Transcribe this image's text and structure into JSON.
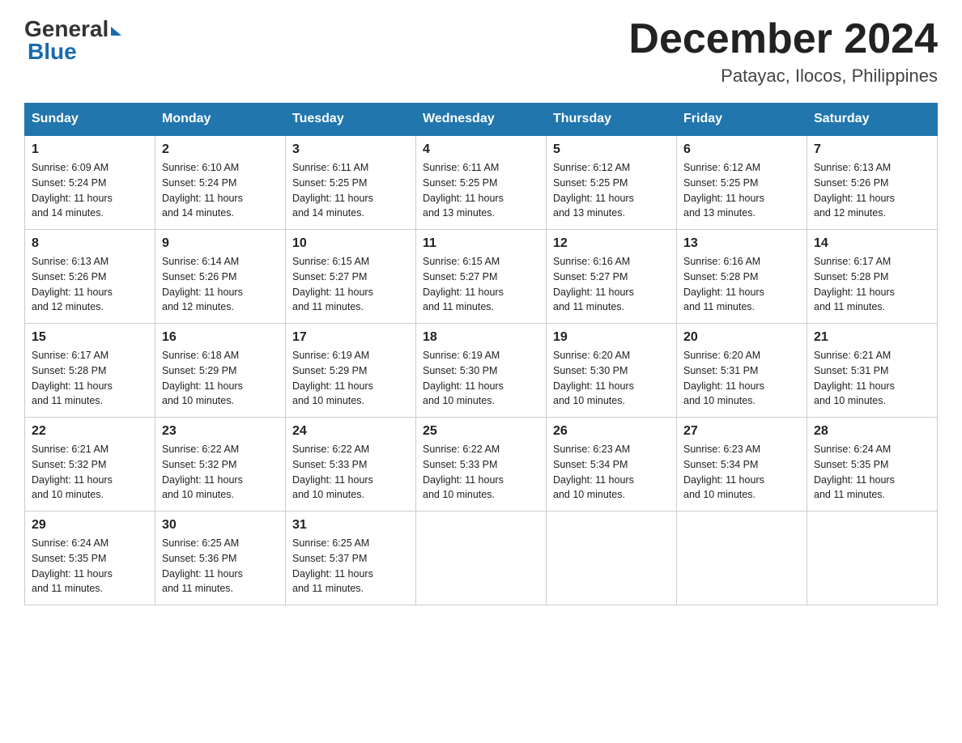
{
  "header": {
    "logo_general": "General",
    "logo_blue": "Blue",
    "month_title": "December 2024",
    "location": "Patayac, Ilocos, Philippines"
  },
  "days_of_week": [
    "Sunday",
    "Monday",
    "Tuesday",
    "Wednesday",
    "Thursday",
    "Friday",
    "Saturday"
  ],
  "weeks": [
    [
      {
        "day": "1",
        "sunrise": "6:09 AM",
        "sunset": "5:24 PM",
        "daylight": "11 hours and 14 minutes."
      },
      {
        "day": "2",
        "sunrise": "6:10 AM",
        "sunset": "5:24 PM",
        "daylight": "11 hours and 14 minutes."
      },
      {
        "day": "3",
        "sunrise": "6:11 AM",
        "sunset": "5:25 PM",
        "daylight": "11 hours and 14 minutes."
      },
      {
        "day": "4",
        "sunrise": "6:11 AM",
        "sunset": "5:25 PM",
        "daylight": "11 hours and 13 minutes."
      },
      {
        "day": "5",
        "sunrise": "6:12 AM",
        "sunset": "5:25 PM",
        "daylight": "11 hours and 13 minutes."
      },
      {
        "day": "6",
        "sunrise": "6:12 AM",
        "sunset": "5:25 PM",
        "daylight": "11 hours and 13 minutes."
      },
      {
        "day": "7",
        "sunrise": "6:13 AM",
        "sunset": "5:26 PM",
        "daylight": "11 hours and 12 minutes."
      }
    ],
    [
      {
        "day": "8",
        "sunrise": "6:13 AM",
        "sunset": "5:26 PM",
        "daylight": "11 hours and 12 minutes."
      },
      {
        "day": "9",
        "sunrise": "6:14 AM",
        "sunset": "5:26 PM",
        "daylight": "11 hours and 12 minutes."
      },
      {
        "day": "10",
        "sunrise": "6:15 AM",
        "sunset": "5:27 PM",
        "daylight": "11 hours and 11 minutes."
      },
      {
        "day": "11",
        "sunrise": "6:15 AM",
        "sunset": "5:27 PM",
        "daylight": "11 hours and 11 minutes."
      },
      {
        "day": "12",
        "sunrise": "6:16 AM",
        "sunset": "5:27 PM",
        "daylight": "11 hours and 11 minutes."
      },
      {
        "day": "13",
        "sunrise": "6:16 AM",
        "sunset": "5:28 PM",
        "daylight": "11 hours and 11 minutes."
      },
      {
        "day": "14",
        "sunrise": "6:17 AM",
        "sunset": "5:28 PM",
        "daylight": "11 hours and 11 minutes."
      }
    ],
    [
      {
        "day": "15",
        "sunrise": "6:17 AM",
        "sunset": "5:28 PM",
        "daylight": "11 hours and 11 minutes."
      },
      {
        "day": "16",
        "sunrise": "6:18 AM",
        "sunset": "5:29 PM",
        "daylight": "11 hours and 10 minutes."
      },
      {
        "day": "17",
        "sunrise": "6:19 AM",
        "sunset": "5:29 PM",
        "daylight": "11 hours and 10 minutes."
      },
      {
        "day": "18",
        "sunrise": "6:19 AM",
        "sunset": "5:30 PM",
        "daylight": "11 hours and 10 minutes."
      },
      {
        "day": "19",
        "sunrise": "6:20 AM",
        "sunset": "5:30 PM",
        "daylight": "11 hours and 10 minutes."
      },
      {
        "day": "20",
        "sunrise": "6:20 AM",
        "sunset": "5:31 PM",
        "daylight": "11 hours and 10 minutes."
      },
      {
        "day": "21",
        "sunrise": "6:21 AM",
        "sunset": "5:31 PM",
        "daylight": "11 hours and 10 minutes."
      }
    ],
    [
      {
        "day": "22",
        "sunrise": "6:21 AM",
        "sunset": "5:32 PM",
        "daylight": "11 hours and 10 minutes."
      },
      {
        "day": "23",
        "sunrise": "6:22 AM",
        "sunset": "5:32 PM",
        "daylight": "11 hours and 10 minutes."
      },
      {
        "day": "24",
        "sunrise": "6:22 AM",
        "sunset": "5:33 PM",
        "daylight": "11 hours and 10 minutes."
      },
      {
        "day": "25",
        "sunrise": "6:22 AM",
        "sunset": "5:33 PM",
        "daylight": "11 hours and 10 minutes."
      },
      {
        "day": "26",
        "sunrise": "6:23 AM",
        "sunset": "5:34 PM",
        "daylight": "11 hours and 10 minutes."
      },
      {
        "day": "27",
        "sunrise": "6:23 AM",
        "sunset": "5:34 PM",
        "daylight": "11 hours and 10 minutes."
      },
      {
        "day": "28",
        "sunrise": "6:24 AM",
        "sunset": "5:35 PM",
        "daylight": "11 hours and 11 minutes."
      }
    ],
    [
      {
        "day": "29",
        "sunrise": "6:24 AM",
        "sunset": "5:35 PM",
        "daylight": "11 hours and 11 minutes."
      },
      {
        "day": "30",
        "sunrise": "6:25 AM",
        "sunset": "5:36 PM",
        "daylight": "11 hours and 11 minutes."
      },
      {
        "day": "31",
        "sunrise": "6:25 AM",
        "sunset": "5:37 PM",
        "daylight": "11 hours and 11 minutes."
      },
      null,
      null,
      null,
      null
    ]
  ],
  "labels": {
    "sunrise": "Sunrise:",
    "sunset": "Sunset:",
    "daylight": "Daylight:"
  }
}
